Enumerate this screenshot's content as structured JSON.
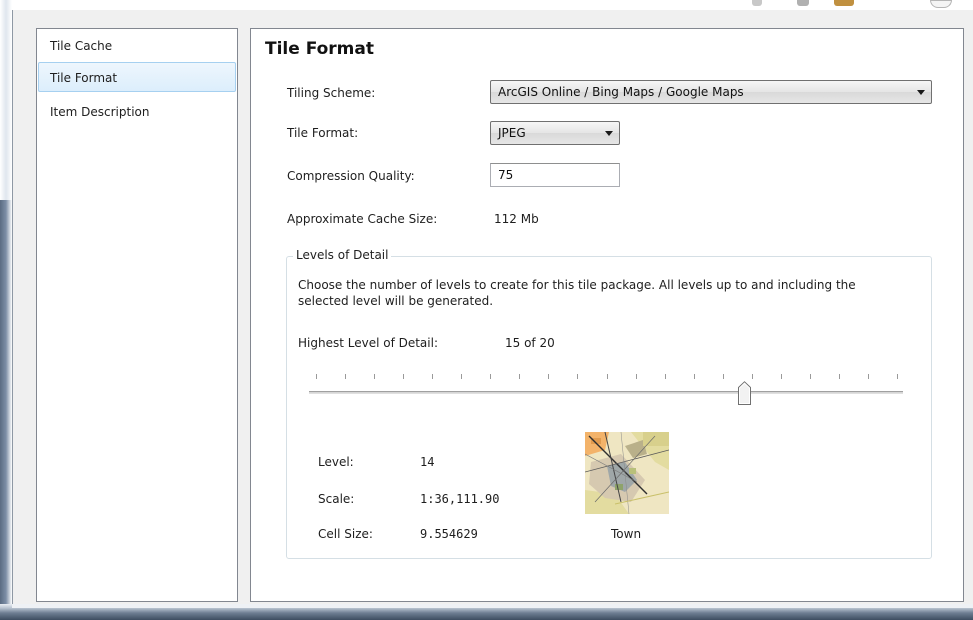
{
  "nav": {
    "items": [
      {
        "label": "Tile Cache",
        "selected": false
      },
      {
        "label": "Tile Format",
        "selected": true
      },
      {
        "label": "Item Description",
        "selected": false
      }
    ]
  },
  "main": {
    "title": "Tile Format",
    "tiling_scheme": {
      "label": "Tiling Scheme:",
      "value": "ArcGIS Online / Bing Maps / Google Maps"
    },
    "tile_format": {
      "label": "Tile Format:",
      "value": "JPEG"
    },
    "compression_quality": {
      "label": "Compression Quality:",
      "value": "75"
    },
    "cache_size": {
      "label": "Approximate Cache Size:",
      "value": "112 Mb"
    },
    "levels_of_detail": {
      "legend": "Levels of Detail",
      "description": "Choose the number of levels to create for this tile package.   All levels up to and including the selected level will be generated.",
      "highest_label": "Highest Level of Detail:",
      "highest_value": "15 of 20",
      "slider": {
        "value": 15,
        "max": 20
      },
      "level_label": "Level:",
      "level_value": "14",
      "scale_label": "Scale:",
      "scale_value": "1:36,111.90",
      "cell_size_label": "Cell Size:",
      "cell_size_value": "9.554629",
      "thumbnail_caption": "Town"
    }
  },
  "colors": {
    "selected_bg": "#dceefc",
    "selected_border": "#a6d0f0",
    "panel_border": "#828790",
    "window_bg": "#f0f0f0"
  }
}
